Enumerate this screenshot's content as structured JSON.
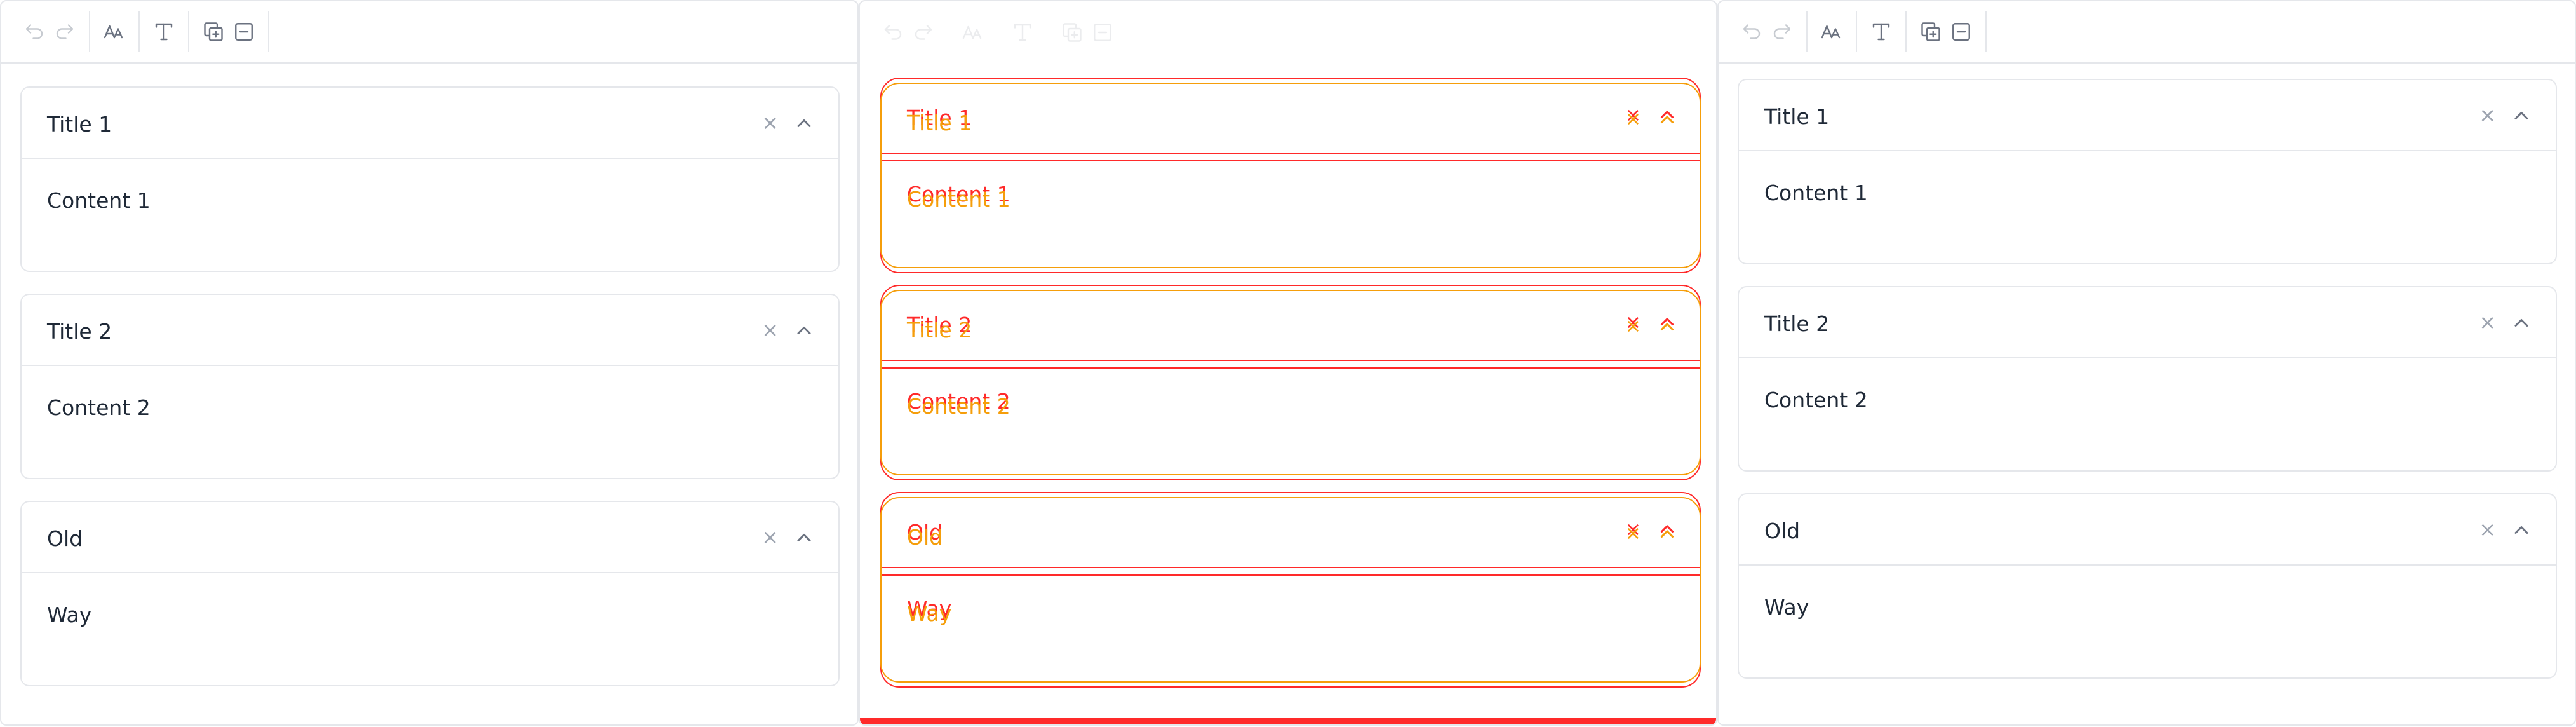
{
  "toolbar": {
    "icons": [
      "undo-icon",
      "redo-icon",
      "font-size-icon",
      "text-format-icon",
      "add-copy-icon",
      "remove-icon"
    ]
  },
  "panels": [
    {
      "items": [
        {
          "title": "Title 1",
          "content": "Content 1"
        },
        {
          "title": "Title 2",
          "content": "Content 2"
        },
        {
          "title": "Old",
          "content": "Way"
        }
      ]
    },
    {
      "items": [
        {
          "title": "Title 1",
          "content": "Content 1"
        },
        {
          "title": "Title 2",
          "content": "Content 2"
        },
        {
          "title": "Old",
          "content": "Way"
        }
      ]
    },
    {
      "items": [
        {
          "title": "Title 1",
          "content": "Content 1"
        },
        {
          "title": "Title 2",
          "content": "Content 2"
        },
        {
          "title": "Old",
          "content": "Way"
        }
      ]
    }
  ],
  "close_glyph": "×",
  "colors": {
    "border": "#e5e7eb",
    "text": "#1f2937",
    "icon": "#6b7280",
    "icon_disabled": "#c7cbd1",
    "overlay_red": "#ff2a2a",
    "overlay_orange": "#f59e0b"
  }
}
